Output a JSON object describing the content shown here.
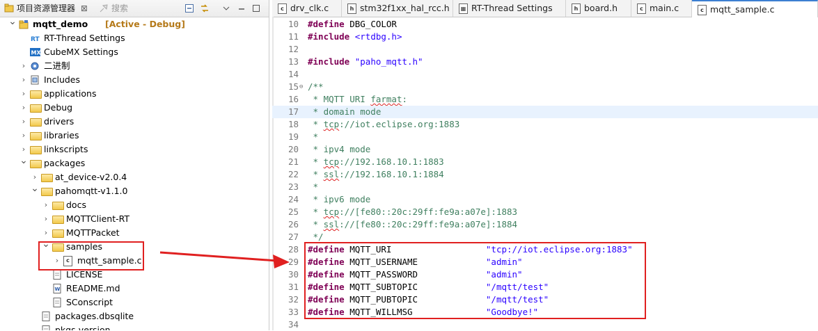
{
  "left_panel": {
    "tab_title": "项目资源管理器",
    "close_glyph": "⊠",
    "search_tab": "搜索"
  },
  "tree": [
    {
      "label": "mqtt_demo",
      "suffix": "[Active - Debug]",
      "icon": "project-icon",
      "expanded": true
    },
    {
      "label": "RT-Thread Settings",
      "icon": "rt-thread-settings-icon"
    },
    {
      "label": "CubeMX Settings",
      "icon": "cubemx-icon"
    },
    {
      "label": "二进制",
      "icon": "binaries-icon"
    },
    {
      "label": "Includes",
      "icon": "includes-icon"
    },
    {
      "label": "applications",
      "icon": "folder-icon"
    },
    {
      "label": "Debug",
      "icon": "folder-icon"
    },
    {
      "label": "drivers",
      "icon": "folder-icon"
    },
    {
      "label": "libraries",
      "icon": "folder-icon"
    },
    {
      "label": "linkscripts",
      "icon": "folder-icon"
    },
    {
      "label": "packages",
      "icon": "folder-icon",
      "expanded": true
    },
    {
      "label": "at_device-v2.0.4",
      "icon": "folder-icon"
    },
    {
      "label": "pahomqtt-v1.1.0",
      "icon": "folder-icon",
      "expanded": true
    },
    {
      "label": "docs",
      "icon": "folder-icon"
    },
    {
      "label": "MQTTClient-RT",
      "icon": "folder-icon"
    },
    {
      "label": "MQTTPacket",
      "icon": "folder-icon"
    },
    {
      "label": "samples",
      "icon": "folder-icon",
      "expanded": true
    },
    {
      "label": "mqtt_sample.c",
      "icon": "c-file-icon"
    },
    {
      "label": "LICENSE",
      "icon": "file-icon"
    },
    {
      "label": "README.md",
      "icon": "markdown-file-icon"
    },
    {
      "label": "SConscript",
      "icon": "file-icon"
    },
    {
      "label": "packages.dbsqlite",
      "icon": "file-icon"
    },
    {
      "label": "pkgs-version",
      "icon": "file-icon"
    }
  ],
  "editor_tabs": [
    {
      "label": "drv_clk.c",
      "icon": "c"
    },
    {
      "label": "stm32f1xx_hal_rcc.h",
      "icon": "h"
    },
    {
      "label": "RT-Thread Settings",
      "icon": "rt"
    },
    {
      "label": "board.h",
      "icon": "h"
    },
    {
      "label": "main.c",
      "icon": "c"
    },
    {
      "label": "mqtt_sample.c",
      "icon": "c",
      "active": true
    }
  ],
  "code_lines": [
    {
      "n": "10",
      "parts": [
        [
          "kw",
          "#define"
        ],
        [
          "",
          "DBG_COLOR"
        ]
      ]
    },
    {
      "n": "11",
      "parts": [
        [
          "kw",
          "#include"
        ],
        [
          "str",
          "<rtdbg.h>"
        ]
      ]
    },
    {
      "n": "12",
      "parts": []
    },
    {
      "n": "13",
      "parts": [
        [
          "kw",
          "#include"
        ],
        [
          "str",
          "\"paho_mqtt.h\""
        ]
      ]
    },
    {
      "n": "14",
      "parts": []
    },
    {
      "n": "15",
      "fold": true,
      "parts": [
        [
          "cmt",
          "/**"
        ]
      ]
    },
    {
      "n": "16",
      "parts": [
        [
          "cmt",
          " * MQTT URI "
        ],
        [
          "cmtsq",
          "farmat"
        ],
        [
          "cmt",
          ":"
        ]
      ]
    },
    {
      "n": "17",
      "hl": true,
      "parts": [
        [
          "cmt",
          " * domain mode"
        ]
      ]
    },
    {
      "n": "18",
      "parts": [
        [
          "cmt",
          " * "
        ],
        [
          "cmtsq",
          "tcp"
        ],
        [
          "cmt",
          "://iot.eclipse.org:1883"
        ]
      ]
    },
    {
      "n": "19",
      "parts": [
        [
          "cmt",
          " *"
        ]
      ]
    },
    {
      "n": "20",
      "parts": [
        [
          "cmt",
          " * ipv4 mode"
        ]
      ]
    },
    {
      "n": "21",
      "parts": [
        [
          "cmt",
          " * "
        ],
        [
          "cmtsq",
          "tcp"
        ],
        [
          "cmt",
          "://192.168.10.1:1883"
        ]
      ]
    },
    {
      "n": "22",
      "parts": [
        [
          "cmt",
          " * "
        ],
        [
          "cmtsq",
          "ssl"
        ],
        [
          "cmt",
          "://192.168.10.1:1884"
        ]
      ]
    },
    {
      "n": "23",
      "parts": [
        [
          "cmt",
          " *"
        ]
      ]
    },
    {
      "n": "24",
      "parts": [
        [
          "cmt",
          " * ipv6 mode"
        ]
      ]
    },
    {
      "n": "25",
      "parts": [
        [
          "cmt",
          " * "
        ],
        [
          "cmtsq",
          "tcp"
        ],
        [
          "cmt",
          "://[fe80::20c:29ff:fe9a:a07e]:1883"
        ]
      ]
    },
    {
      "n": "26",
      "parts": [
        [
          "cmt",
          " * "
        ],
        [
          "cmtsq",
          "ssl"
        ],
        [
          "cmt",
          "://[fe80::20c:29ff:fe9a:a07e]:1884"
        ]
      ]
    },
    {
      "n": "27",
      "parts": [
        [
          "cmt",
          " */"
        ]
      ]
    },
    {
      "n": "28",
      "parts": [
        [
          "kw",
          "#define"
        ],
        [
          "pad",
          "MQTT_URI"
        ],
        [
          "str",
          "\"tcp://iot.eclipse.org:1883\""
        ]
      ]
    },
    {
      "n": "29",
      "parts": [
        [
          "kw",
          "#define"
        ],
        [
          "pad",
          "MQTT_USERNAME"
        ],
        [
          "str",
          "\"admin\""
        ]
      ]
    },
    {
      "n": "30",
      "parts": [
        [
          "kw",
          "#define"
        ],
        [
          "pad",
          "MQTT_PASSWORD"
        ],
        [
          "str",
          "\"admin\""
        ]
      ]
    },
    {
      "n": "31",
      "parts": [
        [
          "kw",
          "#define"
        ],
        [
          "pad",
          "MQTT_SUBTOPIC"
        ],
        [
          "str",
          "\"/mqtt/test\""
        ]
      ]
    },
    {
      "n": "32",
      "parts": [
        [
          "kw",
          "#define"
        ],
        [
          "pad",
          "MQTT_PUBTOPIC"
        ],
        [
          "str",
          "\"/mqtt/test\""
        ]
      ]
    },
    {
      "n": "33",
      "parts": [
        [
          "kw",
          "#define"
        ],
        [
          "pad",
          "MQTT_WILLMSG"
        ],
        [
          "str",
          "\"Goodbye!\""
        ]
      ]
    },
    {
      "n": "34",
      "parts": []
    }
  ],
  "colors": {
    "annotation_red": "#e02020",
    "keyword": "#7f0055",
    "string": "#2a00ff",
    "comment": "#3f7f5f",
    "current_line": "#e8f2fe",
    "active_tab_accent": "#3c7fd1"
  }
}
